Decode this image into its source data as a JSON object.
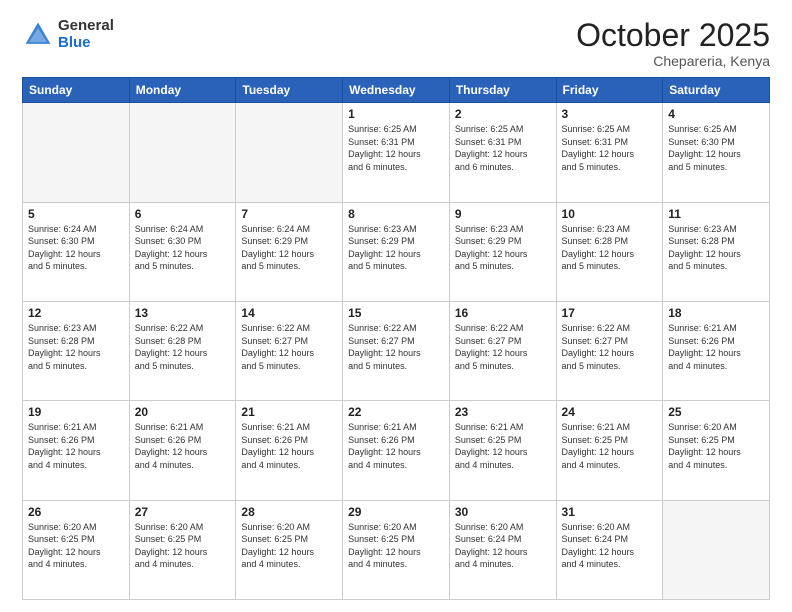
{
  "header": {
    "logo_general": "General",
    "logo_blue": "Blue",
    "month_title": "October 2025",
    "location": "Chepareria, Kenya"
  },
  "weekdays": [
    "Sunday",
    "Monday",
    "Tuesday",
    "Wednesday",
    "Thursday",
    "Friday",
    "Saturday"
  ],
  "weeks": [
    [
      {
        "day": "",
        "info": ""
      },
      {
        "day": "",
        "info": ""
      },
      {
        "day": "",
        "info": ""
      },
      {
        "day": "1",
        "info": "Sunrise: 6:25 AM\nSunset: 6:31 PM\nDaylight: 12 hours\nand 6 minutes."
      },
      {
        "day": "2",
        "info": "Sunrise: 6:25 AM\nSunset: 6:31 PM\nDaylight: 12 hours\nand 6 minutes."
      },
      {
        "day": "3",
        "info": "Sunrise: 6:25 AM\nSunset: 6:31 PM\nDaylight: 12 hours\nand 5 minutes."
      },
      {
        "day": "4",
        "info": "Sunrise: 6:25 AM\nSunset: 6:30 PM\nDaylight: 12 hours\nand 5 minutes."
      }
    ],
    [
      {
        "day": "5",
        "info": "Sunrise: 6:24 AM\nSunset: 6:30 PM\nDaylight: 12 hours\nand 5 minutes."
      },
      {
        "day": "6",
        "info": "Sunrise: 6:24 AM\nSunset: 6:30 PM\nDaylight: 12 hours\nand 5 minutes."
      },
      {
        "day": "7",
        "info": "Sunrise: 6:24 AM\nSunset: 6:29 PM\nDaylight: 12 hours\nand 5 minutes."
      },
      {
        "day": "8",
        "info": "Sunrise: 6:23 AM\nSunset: 6:29 PM\nDaylight: 12 hours\nand 5 minutes."
      },
      {
        "day": "9",
        "info": "Sunrise: 6:23 AM\nSunset: 6:29 PM\nDaylight: 12 hours\nand 5 minutes."
      },
      {
        "day": "10",
        "info": "Sunrise: 6:23 AM\nSunset: 6:28 PM\nDaylight: 12 hours\nand 5 minutes."
      },
      {
        "day": "11",
        "info": "Sunrise: 6:23 AM\nSunset: 6:28 PM\nDaylight: 12 hours\nand 5 minutes."
      }
    ],
    [
      {
        "day": "12",
        "info": "Sunrise: 6:23 AM\nSunset: 6:28 PM\nDaylight: 12 hours\nand 5 minutes."
      },
      {
        "day": "13",
        "info": "Sunrise: 6:22 AM\nSunset: 6:28 PM\nDaylight: 12 hours\nand 5 minutes."
      },
      {
        "day": "14",
        "info": "Sunrise: 6:22 AM\nSunset: 6:27 PM\nDaylight: 12 hours\nand 5 minutes."
      },
      {
        "day": "15",
        "info": "Sunrise: 6:22 AM\nSunset: 6:27 PM\nDaylight: 12 hours\nand 5 minutes."
      },
      {
        "day": "16",
        "info": "Sunrise: 6:22 AM\nSunset: 6:27 PM\nDaylight: 12 hours\nand 5 minutes."
      },
      {
        "day": "17",
        "info": "Sunrise: 6:22 AM\nSunset: 6:27 PM\nDaylight: 12 hours\nand 5 minutes."
      },
      {
        "day": "18",
        "info": "Sunrise: 6:21 AM\nSunset: 6:26 PM\nDaylight: 12 hours\nand 4 minutes."
      }
    ],
    [
      {
        "day": "19",
        "info": "Sunrise: 6:21 AM\nSunset: 6:26 PM\nDaylight: 12 hours\nand 4 minutes."
      },
      {
        "day": "20",
        "info": "Sunrise: 6:21 AM\nSunset: 6:26 PM\nDaylight: 12 hours\nand 4 minutes."
      },
      {
        "day": "21",
        "info": "Sunrise: 6:21 AM\nSunset: 6:26 PM\nDaylight: 12 hours\nand 4 minutes."
      },
      {
        "day": "22",
        "info": "Sunrise: 6:21 AM\nSunset: 6:26 PM\nDaylight: 12 hours\nand 4 minutes."
      },
      {
        "day": "23",
        "info": "Sunrise: 6:21 AM\nSunset: 6:25 PM\nDaylight: 12 hours\nand 4 minutes."
      },
      {
        "day": "24",
        "info": "Sunrise: 6:21 AM\nSunset: 6:25 PM\nDaylight: 12 hours\nand 4 minutes."
      },
      {
        "day": "25",
        "info": "Sunrise: 6:20 AM\nSunset: 6:25 PM\nDaylight: 12 hours\nand 4 minutes."
      }
    ],
    [
      {
        "day": "26",
        "info": "Sunrise: 6:20 AM\nSunset: 6:25 PM\nDaylight: 12 hours\nand 4 minutes."
      },
      {
        "day": "27",
        "info": "Sunrise: 6:20 AM\nSunset: 6:25 PM\nDaylight: 12 hours\nand 4 minutes."
      },
      {
        "day": "28",
        "info": "Sunrise: 6:20 AM\nSunset: 6:25 PM\nDaylight: 12 hours\nand 4 minutes."
      },
      {
        "day": "29",
        "info": "Sunrise: 6:20 AM\nSunset: 6:25 PM\nDaylight: 12 hours\nand 4 minutes."
      },
      {
        "day": "30",
        "info": "Sunrise: 6:20 AM\nSunset: 6:24 PM\nDaylight: 12 hours\nand 4 minutes."
      },
      {
        "day": "31",
        "info": "Sunrise: 6:20 AM\nSunset: 6:24 PM\nDaylight: 12 hours\nand 4 minutes."
      },
      {
        "day": "",
        "info": ""
      }
    ]
  ]
}
